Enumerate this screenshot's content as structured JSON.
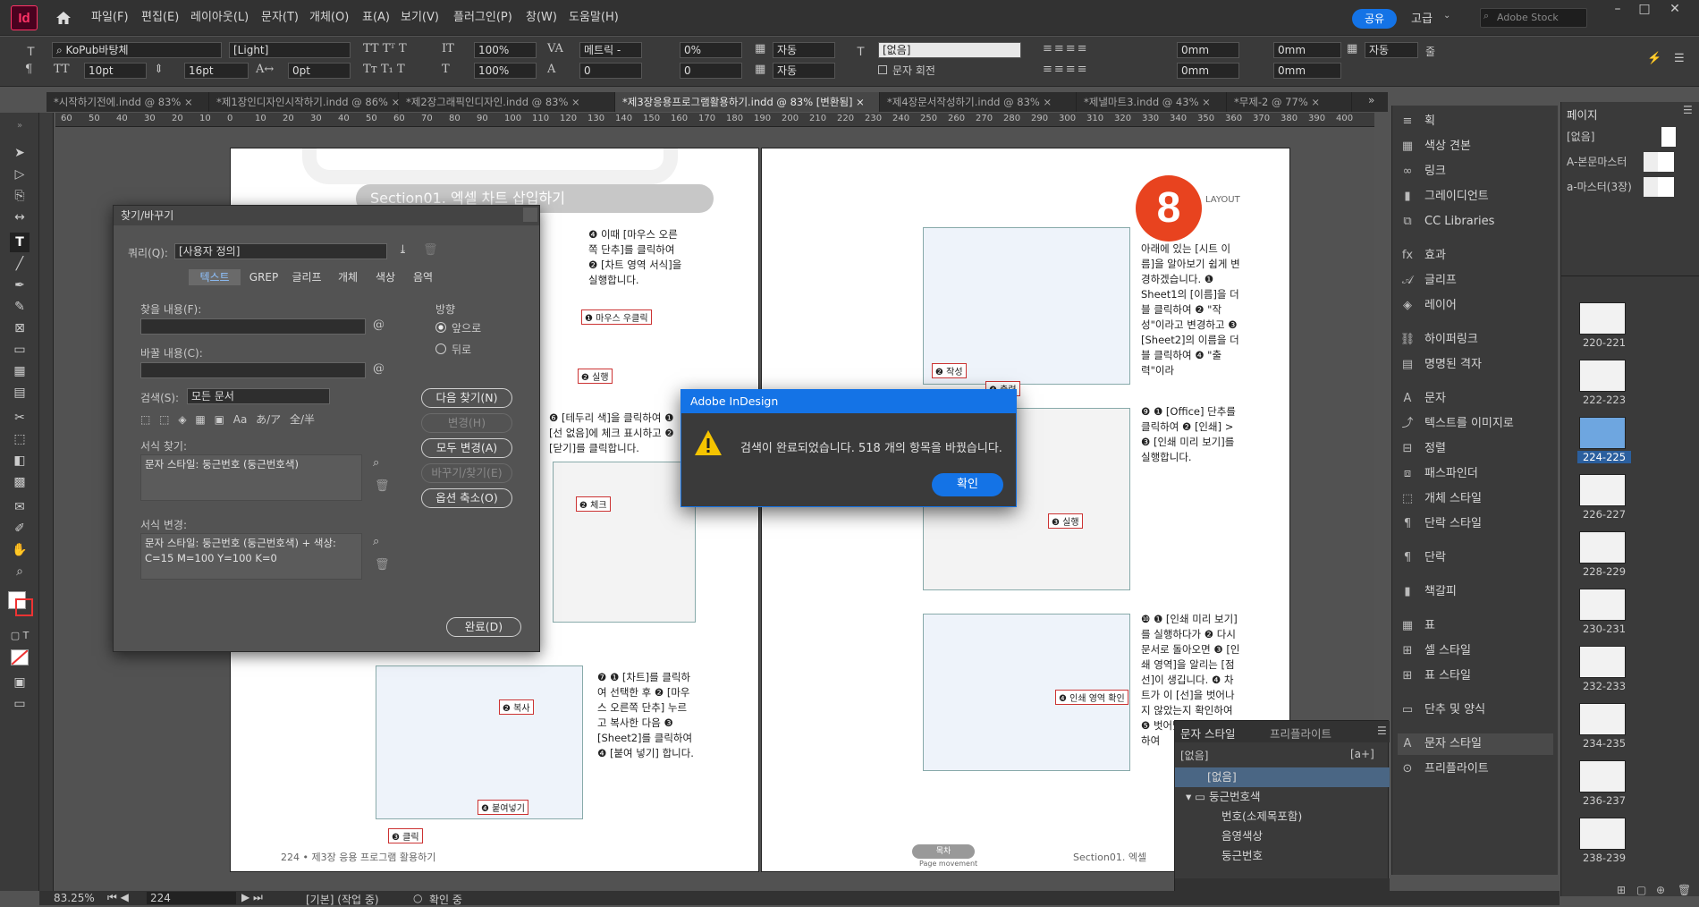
{
  "app": {
    "logo": "Id"
  },
  "menu": [
    "파일(F)",
    "편집(E)",
    "레이아웃(L)",
    "문자(T)",
    "개체(O)",
    "표(A)",
    "보기(V)",
    "플러그인(P)",
    "창(W)",
    "도움말(H)"
  ],
  "topright": {
    "share": "공유",
    "workspace": "고급",
    "search_placeholder": "Adobe Stock"
  },
  "control": {
    "font": "KoPub바탕체",
    "style": "[Light]",
    "size": "10pt",
    "leading": "16pt",
    "scale_v": "100%",
    "scale_h": "100%",
    "kerning": "메트릭 -",
    "tracking": "0%",
    "baseline": "0",
    "skew": "0",
    "lang": "자동",
    "lang2": "자동",
    "char_style": "[없음]",
    "rotate_label": "문자 회전",
    "tracking2": "0pt",
    "indent1": "0mm",
    "indent2": "0mm",
    "indent3": "0mm",
    "indent4": "0mm",
    "para_auto": "자동",
    "para_last": "줄"
  },
  "tabs": [
    {
      "label": "*시작하기전에.indd @ 83%",
      "active": false
    },
    {
      "label": "*제1장인디자인시작하기.indd @ 86%",
      "active": false
    },
    {
      "label": "*제2장그래픽인디자인.indd @ 83%",
      "active": false
    },
    {
      "label": "*제3장응용프로그램활용하기.indd @ 83% [변환됨]",
      "active": true
    },
    {
      "label": "*제4장문서작성하기.indd @ 83%",
      "active": false
    },
    {
      "label": "*제낼마트3.indd @ 43%",
      "active": false
    },
    {
      "label": "*무제-2 @ 77%",
      "active": false
    }
  ],
  "ruler_ticks": [
    "60",
    "50",
    "40",
    "30",
    "20",
    "10",
    "0",
    "10",
    "20",
    "30",
    "40",
    "50",
    "60",
    "70",
    "80",
    "90",
    "100",
    "110",
    "120",
    "130",
    "140",
    "150",
    "160",
    "170",
    "180",
    "190",
    "200",
    "210",
    "220",
    "230",
    "240",
    "250",
    "260",
    "270",
    "280",
    "290",
    "300",
    "310",
    "320",
    "330",
    "340",
    "350",
    "360",
    "370",
    "380",
    "390",
    "400"
  ],
  "findreplace": {
    "title": "찾기/바꾸기",
    "query_label": "쿼리(Q):",
    "query_value": "[사용자 정의]",
    "tabs": [
      "텍스트",
      "GREP",
      "글리프",
      "개체",
      "색상",
      "음역"
    ],
    "find_label": "찾을 내용(F):",
    "change_label": "바꿀 내용(C):",
    "search_label": "검색(S):",
    "search_value": "모든 문서",
    "direction_label": "방향",
    "dir_forward": "앞으로",
    "dir_back": "뒤로",
    "find_format_label": "서식 찾기:",
    "find_format_value": "문자 스타일: 둥근번호 (둥근번호색)",
    "change_format_label": "서식 변경:",
    "change_format_value": "문자 스타일: 둥근번호 (둥근번호색) + 색상: C=15 M=100 Y=100 K=0",
    "btn_find_next": "다음 찾기(N)",
    "btn_change": "변경(H)",
    "btn_change_all": "모두 변경(A)",
    "btn_change_find": "바꾸기/찾기(E)",
    "btn_fewer": "옵션 축소(O)",
    "btn_done": "완료(D)",
    "opt_icons": [
      "Aa",
      "あ/ア",
      "全/半"
    ]
  },
  "alert": {
    "title": "Adobe InDesign",
    "message": "검색이 완료되었습니다. 518 개의 항목을 바꿨습니다.",
    "ok": "확인"
  },
  "doc": {
    "section_title": "Section01. 엑셀 차트 삽입하기",
    "step_big": "8",
    "layout_tag": "LAYOUT",
    "left_footer": "224 • 제3장 응용 프로그램 활용하기",
    "right_footer": "Section01. 엑셀",
    "nav_label": "목차",
    "nav_sub": "Page movement",
    "step4": "❹ 이때 [마우스 오른쪽 단추]를 클릭하여 ❷ [차트 영역 서식]을 실행합니다.",
    "step6": "❻ [테두리 색]을 클릭하여 ❶ [선 없음]에 체크 표시하고 ❷ [닫기]를 클릭합니다.",
    "step7": "❼ ❶ [차트]를 클릭하여 선택한 후 ❷ [마우스 오른쪽 단추] 누르고 복사한 다음 ❸ [Sheet2]를 클릭하여 ❹ [붙여 넣기] 합니다.",
    "step8": "아래에 있는 [시트 이름]을 알아보기 쉽게 변경하겠습니다. ❶ Sheet1의 [이름]을 더블 클릭하여 ❷ \"작성\"이라고 변경하고 ❸ [Sheet2]의 이름을 더블 클릭하여 ❹ \"출력\"이라",
    "step9": "❾ ❶ [Office] 단추를 클릭하여 ❷ [인쇄] > ❸ [인쇄 미리 보기]를 실행합니다.",
    "step10": "❿ ❶ [인쇄 미리 보기]를 실행하다가 ❷ 다시 문서로 돌아오면 ❸ [인쇄 영역]을 알리는 [점선]이 생깁니다. ❹ 차트가 이 [선]을 벗어나지 않았는지 확인하여 ❺ 벗어났다면 ... 이동하여",
    "callouts": [
      "❶ 마우스 우클릭",
      "❷ 실행",
      "❷ 체크",
      "❷ 복사",
      "❹ 붙여넣기",
      "❸ 클릭",
      "❷ 작성",
      "❹ 출력",
      "❸ 실행",
      "❹ 인쇄 영역 확인"
    ]
  },
  "rpanel1": [
    {
      "label": "획",
      "icon": "stroke-icon"
    },
    {
      "label": "색상 견본",
      "icon": "swatches-icon"
    },
    {
      "label": "링크",
      "icon": "link-icon"
    },
    {
      "label": "그레이디언트",
      "icon": "gradient-icon"
    },
    {
      "label": "CC Libraries",
      "icon": "library-icon"
    },
    {
      "label": "효과",
      "icon": "fx-icon"
    },
    {
      "label": "글리프",
      "icon": "glyph-icon"
    },
    {
      "label": "레이어",
      "icon": "layers-icon"
    },
    {
      "label": "하이퍼링크",
      "icon": "hyperlink-icon"
    },
    {
      "label": "명명된 격자",
      "icon": "grid-icon"
    },
    {
      "label": "문자",
      "icon": "character-icon"
    },
    {
      "label": "텍스트를 이미지로",
      "icon": "text-image-icon"
    },
    {
      "label": "정렬",
      "icon": "align-icon"
    },
    {
      "label": "패스파인더",
      "icon": "pathfinder-icon"
    },
    {
      "label": "개체 스타일",
      "icon": "object-style-icon"
    },
    {
      "label": "단락 스타일",
      "icon": "para-style-icon"
    },
    {
      "label": "단락",
      "icon": "paragraph-icon"
    },
    {
      "label": "책갈피",
      "icon": "bookmark-icon"
    },
    {
      "label": "표",
      "icon": "table-icon"
    },
    {
      "label": "셀 스타일",
      "icon": "cell-style-icon"
    },
    {
      "label": "표 스타일",
      "icon": "table-style-icon"
    },
    {
      "label": "단추 및 양식",
      "icon": "buttons-icon"
    },
    {
      "label": "문자 스타일",
      "icon": "char-style-icon"
    },
    {
      "label": "프리플라이트",
      "icon": "preflight-icon"
    }
  ],
  "pages_panel": {
    "title": "페이지",
    "masters": [
      "[없음]",
      "A-본문마스터",
      "a-마스터(3장)"
    ],
    "spreads": [
      "220-221",
      "222-223",
      "224-225",
      "226-227",
      "228-229",
      "230-231",
      "232-233",
      "234-235",
      "236-237",
      "238-239"
    ],
    "selected": "224-225"
  },
  "char_panel": {
    "tab1": "문자 스타일",
    "tab2": "프리플라이트",
    "current": "[없음]",
    "plus_label": "[a+]",
    "rows": [
      "[없음]",
      "둥근번호색",
      "번호(소제목포함)",
      "음영색상",
      "둥근번호"
    ]
  },
  "status": {
    "zoom": "83.25%",
    "page": "224",
    "master": "[기본] (작업 중)",
    "preflight": "확인 중"
  }
}
